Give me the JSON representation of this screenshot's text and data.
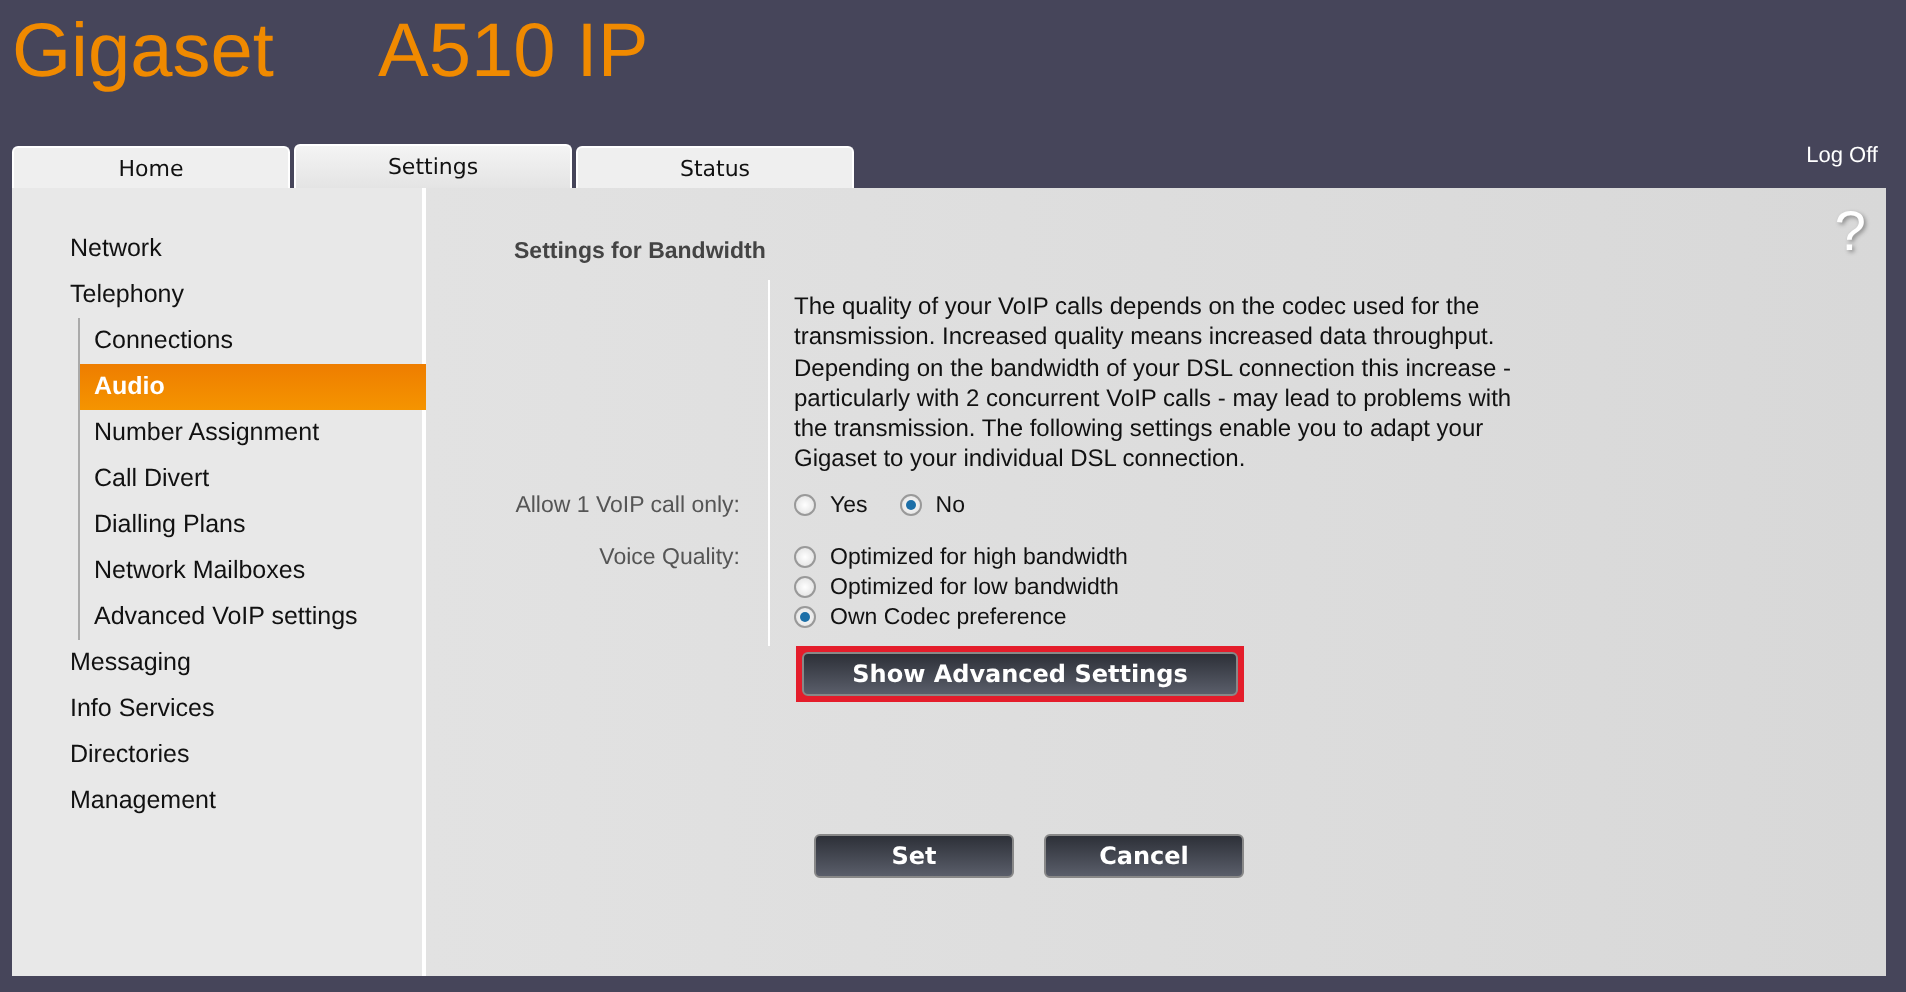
{
  "header": {
    "brand": "Gigaset",
    "model": "A510 IP"
  },
  "tabs": [
    {
      "label": "Home",
      "selected": false
    },
    {
      "label": "Settings",
      "selected": true
    },
    {
      "label": "Status",
      "selected": false
    }
  ],
  "logoff": "Log Off",
  "help": "?",
  "sidebar": {
    "items": [
      {
        "label": "Network",
        "selected": false
      },
      {
        "label": "Telephony",
        "selected": false,
        "children": [
          {
            "label": "Connections",
            "selected": false
          },
          {
            "label": "Audio",
            "selected": true
          },
          {
            "label": "Number Assignment",
            "selected": false
          },
          {
            "label": "Call Divert",
            "selected": false
          },
          {
            "label": "Dialling Plans",
            "selected": false
          },
          {
            "label": "Network Mailboxes",
            "selected": false
          },
          {
            "label": "Advanced VoIP settings",
            "selected": false
          }
        ]
      },
      {
        "label": "Messaging",
        "selected": false
      },
      {
        "label": "Info Services",
        "selected": false
      },
      {
        "label": "Directories",
        "selected": false
      },
      {
        "label": "Management",
        "selected": false
      }
    ]
  },
  "section_title": "Settings for Bandwidth",
  "description": "The quality of your VoIP calls depends on the codec used for the transmission. Increased quality means increased data throughput. Depending on the bandwidth of your DSL connection this increase - particularly with 2 concurrent VoIP calls - may lead to problems with the transmission. The following settings enable you to adapt your Gigaset to your individual DSL connection.",
  "fields": [
    {
      "label": "Allow 1 VoIP call only:",
      "kind": "inline",
      "options": [
        {
          "label": "Yes",
          "selected": false
        },
        {
          "label": "No",
          "selected": true
        }
      ]
    },
    {
      "label": "Voice Quality:",
      "kind": "stacked",
      "options": [
        {
          "label": "Optimized for high bandwidth",
          "selected": false
        },
        {
          "label": "Optimized for low bandwidth",
          "selected": false
        },
        {
          "label": "Own Codec preference",
          "selected": true
        }
      ]
    }
  ],
  "advanced_button": {
    "label": "Show Advanced Settings",
    "highlighted": true
  },
  "buttons": [
    "Set",
    "Cancel"
  ]
}
